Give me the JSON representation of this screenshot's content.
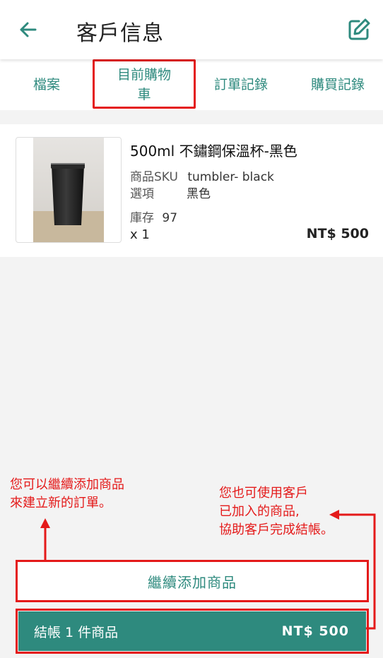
{
  "header": {
    "title": "客戶信息",
    "back_icon": "arrow-left-icon",
    "edit_icon": "edit-square-icon",
    "accent": "#2e8a7e"
  },
  "tabs": [
    {
      "label": "檔案"
    },
    {
      "label": "目前購物\n車"
    },
    {
      "label": "訂單記錄"
    },
    {
      "label": "購買記錄"
    }
  ],
  "cart_item": {
    "name": "500ml 不鏽鋼保溫杯-黑色",
    "sku_label": "商品SKU",
    "sku_value": "tumbler- black",
    "option_label": "選項",
    "option_value": "黑色",
    "stock_label": "庫存",
    "stock_value": "97",
    "qty": "x 1",
    "price": "NT$ 500"
  },
  "annotations": {
    "left": "您可以繼續添加商品\n來建立新的訂單。",
    "right": "您也可使用客戶\n已加入的商品,\n協助客戶完成結帳。",
    "color": "#e41a1a"
  },
  "buttons": {
    "continue_label": "繼續添加商品",
    "checkout_label": "結帳 1 件商品",
    "checkout_price": "NT$ 500"
  }
}
